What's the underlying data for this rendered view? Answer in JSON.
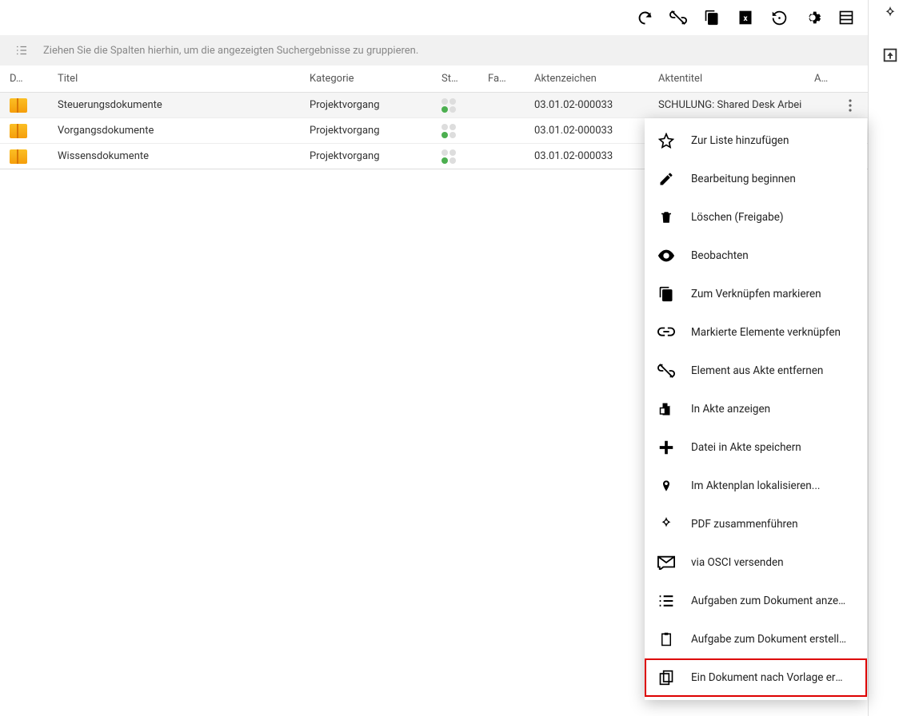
{
  "groupbar": {
    "hint": "Ziehen Sie die Spalten hierhin, um die angezeigten Suchergebnisse zu gruppieren."
  },
  "toolbar": {},
  "columns": {
    "icon": "D…",
    "title": "Titel",
    "category": "Kategorie",
    "st": "St…",
    "fa": "Fa…",
    "az": "Aktenzeichen",
    "at": "Aktentitel",
    "a": "A…"
  },
  "rows": [
    {
      "title": "Steuerungsdokumente",
      "category": "Projektvorgang",
      "az": "03.01.02-000033",
      "at": "SCHULUNG: Shared Desk Arbei",
      "selected": true
    },
    {
      "title": "Vorgangsdokumente",
      "category": "Projektvorgang",
      "az": "03.01.02-000033",
      "at": "",
      "selected": false
    },
    {
      "title": "Wissensdokumente",
      "category": "Projektvorgang",
      "az": "03.01.02-000033",
      "at": "",
      "selected": false
    }
  ],
  "menu": {
    "items": [
      {
        "label": "Zur Liste hinzufügen",
        "icon": "star"
      },
      {
        "label": "Bearbeitung beginnen",
        "icon": "edit"
      },
      {
        "label": "Löschen (Freigabe)",
        "icon": "trash"
      },
      {
        "label": "Beobachten",
        "icon": "eye"
      },
      {
        "label": "Zum Verknüpfen markieren",
        "icon": "paste"
      },
      {
        "label": "Markierte Elemente verknüpfen",
        "icon": "link"
      },
      {
        "label": "Element aus Akte entfernen",
        "icon": "unlink"
      },
      {
        "label": "In Akte anzeigen",
        "icon": "folder"
      },
      {
        "label": "Datei in Akte speichern",
        "icon": "plus"
      },
      {
        "label": "Im Aktenplan lokalisieren...",
        "icon": "pin"
      },
      {
        "label": "PDF zusammenführen",
        "icon": "pdf"
      },
      {
        "label": "via OSCI versenden",
        "icon": "mail"
      },
      {
        "label": "Aufgaben zum Dokument anzei…",
        "icon": "list"
      },
      {
        "label": "Aufgabe zum Dokument erstell…",
        "icon": "clipboard"
      },
      {
        "label": "Ein Dokument nach Vorlage ers…",
        "icon": "copy",
        "highlight": true
      }
    ]
  }
}
